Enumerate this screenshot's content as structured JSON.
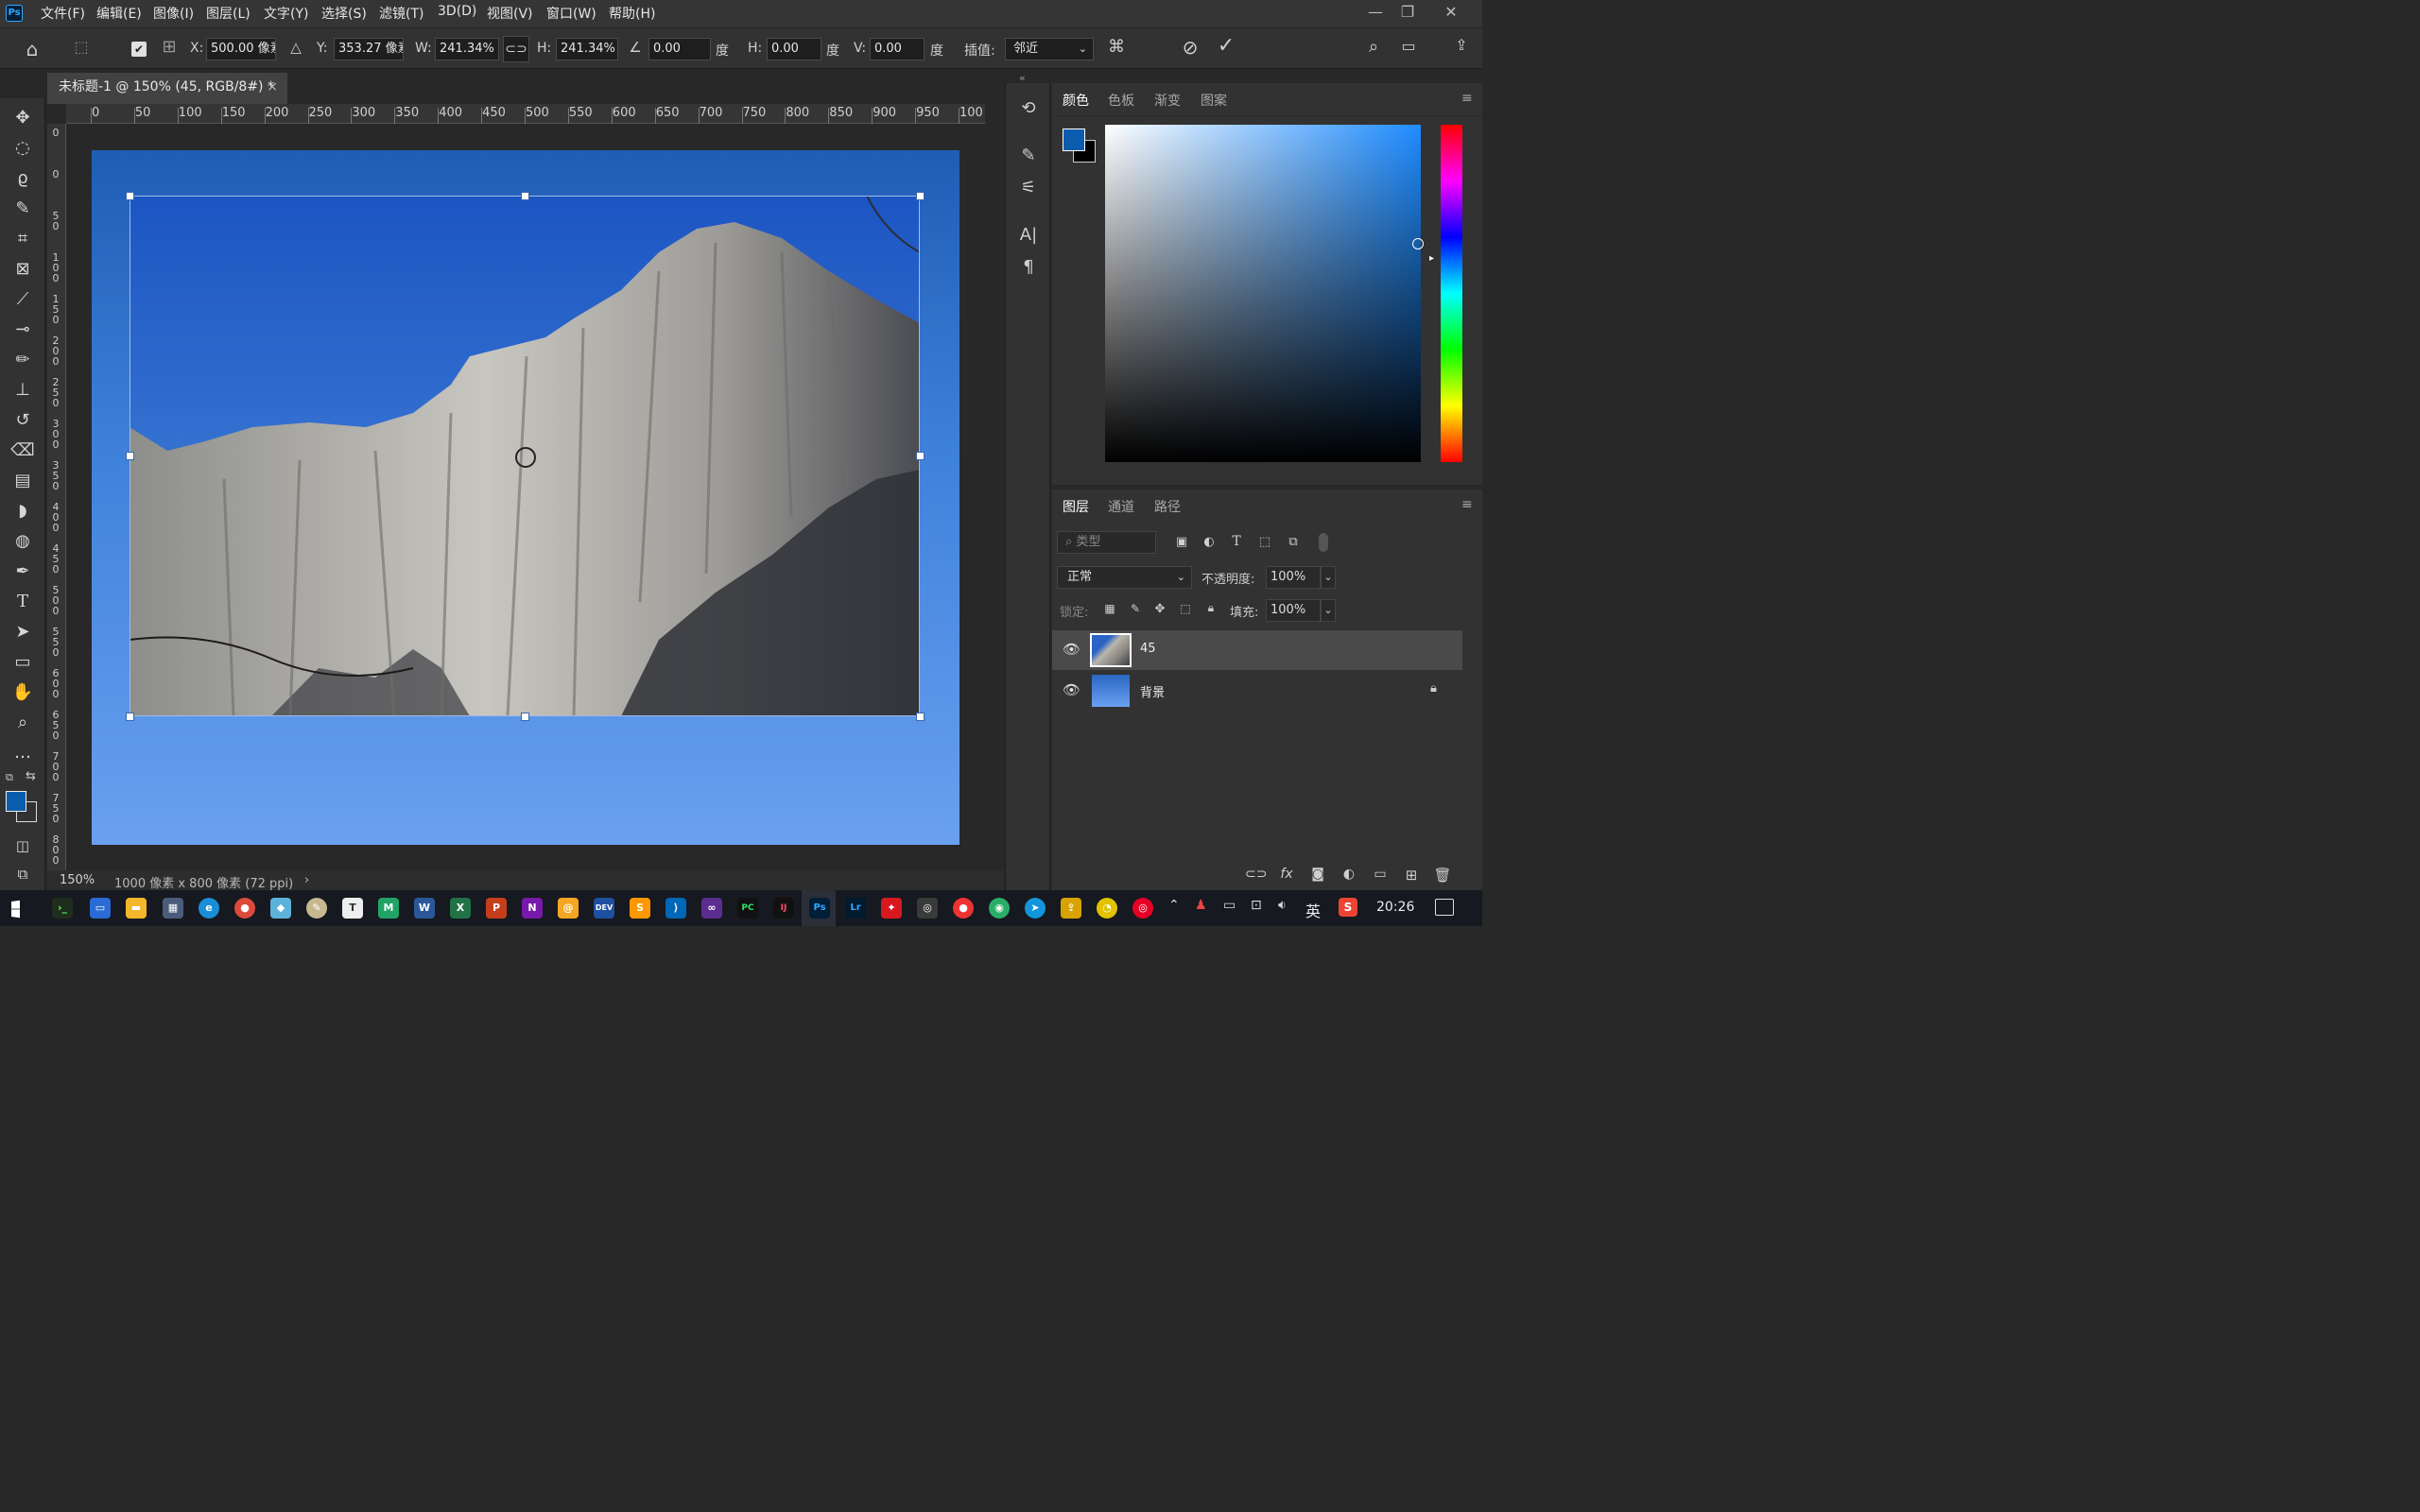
{
  "app": {
    "logo": "Ps",
    "menus": [
      "文件(F)",
      "编辑(E)",
      "图像(I)",
      "图层(L)",
      "文字(Y)",
      "选择(S)",
      "滤镜(T)",
      "3D(D)",
      "视图(V)",
      "窗口(W)",
      "帮助(H)"
    ]
  },
  "options": {
    "x_label": "X:",
    "x_value": "500.00 像素",
    "y_label": "Y:",
    "y_value": "353.27 像素",
    "w_label": "W:",
    "w_value": "241.34%",
    "h_label": "H:",
    "h_value": "241.34%",
    "angle_value": "0.00",
    "angle_unit": "度",
    "skew_h_label": "H:",
    "skew_h_value": "0.00",
    "skew_h_unit": "度",
    "skew_v_label": "V:",
    "skew_v_value": "0.00",
    "skew_v_unit": "度",
    "interp_label": "插值:",
    "interp_value": "邻近"
  },
  "document": {
    "tab_title": "未标题-1 @ 150% (45, RGB/8#) *",
    "zoom": "150%",
    "info": "1000 像素 x 800 像素 (72 ppi)"
  },
  "ruler": {
    "top": [
      "0",
      "50",
      "100",
      "150",
      "200",
      "250",
      "300",
      "350",
      "400",
      "450",
      "500",
      "550",
      "600",
      "650",
      "700",
      "750",
      "800",
      "850",
      "900",
      "950",
      "100"
    ],
    "left": [
      "0",
      "0",
      "50",
      "100",
      "150",
      "200",
      "250",
      "300",
      "350",
      "400",
      "450",
      "500",
      "550",
      "600",
      "650",
      "700",
      "750",
      "800"
    ]
  },
  "color_panel": {
    "tabs": [
      "颜色",
      "色板",
      "渐变",
      "图案"
    ],
    "fg_color": "#0b5cad",
    "bg_color": "#000000"
  },
  "layers_panel": {
    "tabs": [
      "图层",
      "通道",
      "路径"
    ],
    "filter_placeholder": "类型",
    "blend_mode": "正常",
    "opacity_label": "不透明度:",
    "opacity_value": "100%",
    "lock_label": "锁定:",
    "fill_label": "填充:",
    "fill_value": "100%",
    "layers": [
      {
        "name": "45",
        "selected": true
      },
      {
        "name": "背景",
        "locked": true
      }
    ]
  },
  "taskbar": {
    "time": "20:26",
    "ime": "英"
  }
}
